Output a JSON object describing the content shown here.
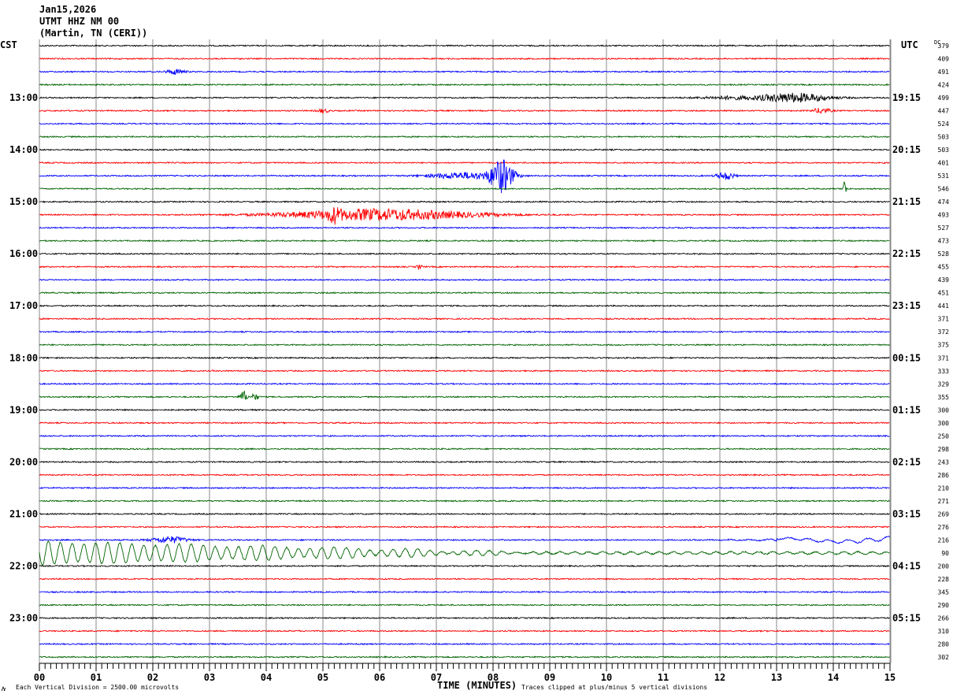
{
  "header": {
    "date": "Jan15,2026",
    "station": "UTMT HHZ NM 00",
    "location": "(Martin, TN (CERI))"
  },
  "chart_data": {
    "type": "line",
    "title": "Jan15,2026 UTMT HHZ NM 00 (Martin, TN (CERI))",
    "left_axis_label": "CST",
    "right_axis_label": "UTC",
    "dc_label": "DC",
    "xlabel": "TIME (MINUTES)",
    "xlim": [
      0,
      15
    ],
    "x_ticks": [
      "00",
      "01",
      "02",
      "03",
      "04",
      "05",
      "06",
      "07",
      "08",
      "09",
      "10",
      "11",
      "12",
      "13",
      "14",
      "15"
    ],
    "left_time_labels": [
      "13:00",
      "14:00",
      "15:00",
      "16:00",
      "17:00",
      "18:00",
      "19:00",
      "20:00",
      "21:00",
      "22:00",
      "23:00"
    ],
    "right_time_labels": [
      "19:15",
      "20:15",
      "21:15",
      "22:15",
      "23:15",
      "00:15",
      "01:15",
      "02:15",
      "03:15",
      "04:15",
      "05:15"
    ],
    "trace_colors": [
      "#000000",
      "#ff0000",
      "#0000ff",
      "#006400"
    ],
    "dc_values": [
      "379",
      "409",
      "491",
      "424",
      "499",
      "447",
      "524",
      "503",
      "503",
      "401",
      "531",
      "546",
      "474",
      "493",
      "527",
      "473",
      "528",
      "455",
      "439",
      "451",
      "441",
      "371",
      "372",
      "375",
      "371",
      "333",
      "329",
      "355",
      "300",
      "300",
      "250",
      "298",
      "243",
      "286",
      "210",
      "271",
      "269",
      "276",
      "216",
      "90",
      "200",
      "228",
      "345",
      "290",
      "266",
      "310",
      "280",
      "302"
    ],
    "grid": true,
    "scale_note": "Each Vertical Division = 2500.00 microvolts",
    "clip_note": "Traces clipped at plus/minus 5 vertical divisions"
  }
}
